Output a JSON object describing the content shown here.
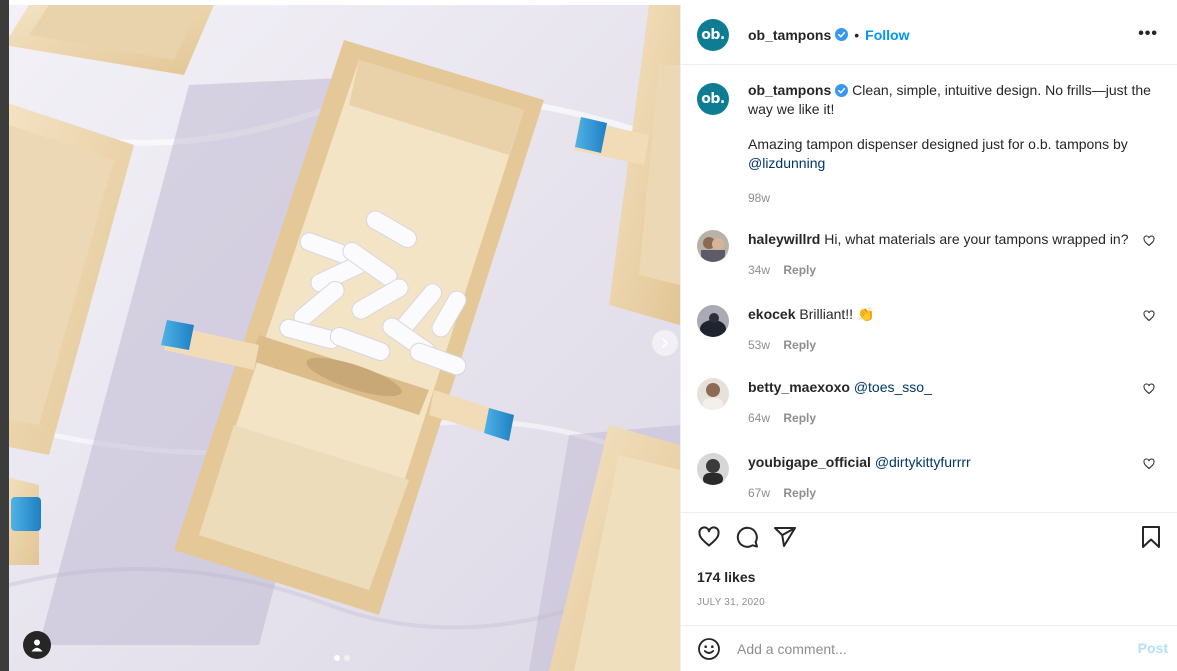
{
  "post": {
    "brand_initials": "ob.",
    "handle": "ob_tampons",
    "follow_label": "Follow",
    "separator": "•",
    "more_label": "•••",
    "caption_line1": "Clean, simple, intuitive design. No frills—just the way we like it!",
    "caption_line2_prefix": "Amazing tampon dispenser designed just for o.b. tampons by",
    "caption_mention": "@lizdunning",
    "caption_time": "98w",
    "likes": "174 likes",
    "date": "JULY 31, 2020"
  },
  "comments": [
    {
      "user": "haleywillrd",
      "text": "Hi, what materials are your tampons wrapped in?",
      "mention": "",
      "time": "34w",
      "reply": "Reply"
    },
    {
      "user": "ekocek",
      "text": "Brilliant!! 👏",
      "mention": "",
      "time": "53w",
      "reply": "Reply"
    },
    {
      "user": "betty_maexoxo",
      "text": "",
      "mention": "@toes_sso_",
      "time": "64w",
      "reply": "Reply"
    },
    {
      "user": "youbigape_official",
      "text": "",
      "mention": "@dirtykittyfurrrr",
      "time": "67w",
      "reply": "Reply"
    }
  ],
  "composer": {
    "placeholder": "Add a comment...",
    "post_label": "Post"
  },
  "colors": {
    "brand": "#0e7d93",
    "link_blue": "#0095f6",
    "mention": "#00376b",
    "muted": "#8e8e8e"
  },
  "icons": [
    "verified-badge-icon",
    "more-options-icon",
    "heart-icon",
    "comment-icon",
    "share-icon",
    "bookmark-icon",
    "emoji-icon",
    "chevron-right-icon",
    "user-tag-icon"
  ]
}
